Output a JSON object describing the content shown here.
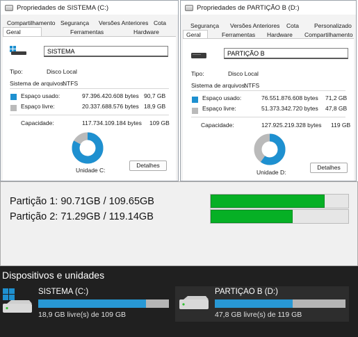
{
  "dialog1": {
    "title": "Propriedades de SISTEMA (C:)",
    "tabs_row1": [
      "Compartilhamento",
      "Segurança",
      "Versões Anteriores",
      "Cota"
    ],
    "tabs_row2": [
      "Geral",
      "Ferramentas",
      "Hardware"
    ],
    "name_value": "SISTEMA",
    "type_label": "Tipo:",
    "type_value": "Disco Local",
    "fs_label": "Sistema de arquivos:",
    "fs_value": "NTFS",
    "used_label": "Espaço usado:",
    "used_bytes": "97.396.420.608 bytes",
    "used_gb": "90,7 GB",
    "free_label": "Espaço livre:",
    "free_bytes": "20.337.688.576 bytes",
    "free_gb": "18,9 GB",
    "capacity_label": "Capacidade:",
    "capacity_bytes": "117.734.109.184 bytes",
    "capacity_gb": "109 GB",
    "unit_label": "Unidade C:",
    "details_button": "Detalhes",
    "used_fraction": 0.827
  },
  "dialog2": {
    "title": "Propriedades de PARTIÇÃO B (D:)",
    "tabs_row1": [
      "Segurança",
      "Versões Anteriores",
      "Cota",
      "Personalizado"
    ],
    "tabs_row2": [
      "Geral",
      "Ferramentas",
      "Hardware",
      "Compartilhamento"
    ],
    "name_value": "PARTIÇÃO B",
    "type_label": "Tipo:",
    "type_value": "Disco Local",
    "fs_label": "Sistema de arquivos:",
    "fs_value": "NTFS",
    "used_label": "Espaço usado:",
    "used_bytes": "76.551.876.608 bytes",
    "used_gb": "71,2 GB",
    "free_label": "Espaço livre:",
    "free_bytes": "51.373.342.720 bytes",
    "free_gb": "47,8 GB",
    "capacity_label": "Capacidade:",
    "capacity_bytes": "127.925.219.328 bytes",
    "capacity_gb": "119 GB",
    "unit_label": "Unidade D:",
    "details_button": "Detalhes",
    "used_fraction": 0.598
  },
  "partitions": [
    {
      "label": "Partição 1: 90.71GB / 109.65GB",
      "fraction": 0.827
    },
    {
      "label": "Partição 2: 71.29GB / 119.14GB",
      "fraction": 0.598
    }
  ],
  "devices": {
    "heading": "Dispositivos e unidades",
    "items": [
      {
        "name": "SISTEMA (C:)",
        "sub": "18,9 GB livre(s) de 109 GB",
        "fraction": 0.827
      },
      {
        "name": "PARTIÇAO B (D:)",
        "sub": "47,8 GB livre(s) de 119 GB",
        "fraction": 0.598
      }
    ]
  },
  "colors": {
    "used": "#1e90d0",
    "free": "#bababa",
    "progress_green": "#06b025",
    "tile_blue": "#2898d5"
  }
}
